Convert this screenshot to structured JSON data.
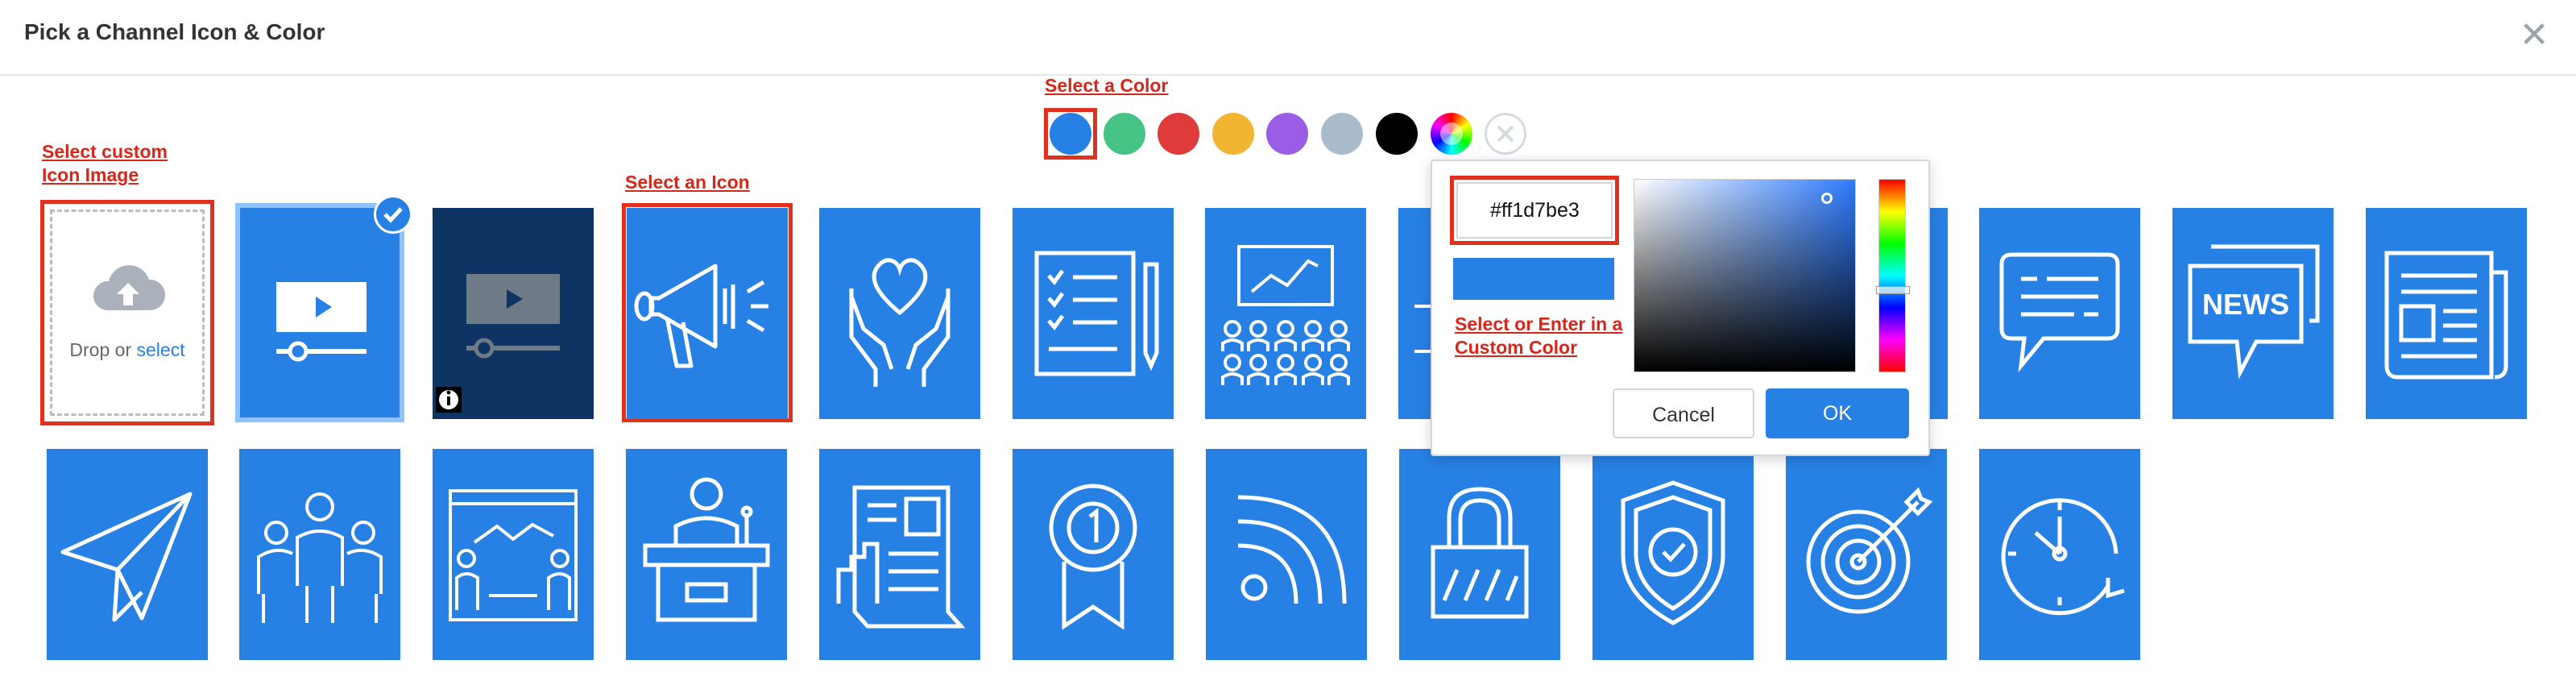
{
  "dialog": {
    "title": "Pick a Channel Icon & Color",
    "close_label": "✕"
  },
  "annotations": {
    "select_color": "Select a Color",
    "custom_image_line1": "Select custom",
    "custom_image_line2": "Icon Image",
    "select_icon": "Select an Icon",
    "custom_color_line1": "Select or Enter in a",
    "custom_color_line2": "Custom Color"
  },
  "colors": {
    "swatches": [
      {
        "name": "blue",
        "hex": "#2780e3",
        "selected": true
      },
      {
        "name": "green",
        "hex": "#45c486"
      },
      {
        "name": "red",
        "hex": "#e03b3b"
      },
      {
        "name": "yellow",
        "hex": "#f2b531"
      },
      {
        "name": "purple",
        "hex": "#9b5de5"
      },
      {
        "name": "gray",
        "hex": "#aabbcc"
      },
      {
        "name": "black",
        "hex": "#000000"
      },
      {
        "name": "rainbow",
        "icon": "color-wheel-icon"
      },
      {
        "name": "none",
        "icon": "no-color-icon"
      }
    ],
    "accent": "#2780e3",
    "annotation_red": "#d7261a"
  },
  "upload": {
    "drop_text": "Drop or",
    "select_link": "select",
    "icon": "cloud-upload-icon"
  },
  "color_picker": {
    "hex_value": "#ff1d7be3",
    "cancel_label": "Cancel",
    "ok_label": "OK",
    "preview_color": "#2780e3"
  },
  "icons_row1": [
    "video-player-icon",
    "video-player-dark-icon",
    "megaphone-icon",
    "hands-heart-icon",
    "checklist-icon",
    "presentation-audience-icon",
    "hidden-icon",
    "hidden-icon",
    "chat-bubble-icon",
    "news-bubble-icon",
    "newspaper-icon"
  ],
  "icons_row2": [
    "paper-plane-icon",
    "team-people-icon",
    "whiteboard-meeting-icon",
    "speaker-podium-icon",
    "report-document-icon",
    "award-ribbon-icon",
    "rss-feed-icon",
    "padlock-icon",
    "shield-check-icon",
    "target-dart-icon",
    "clock-refresh-icon"
  ],
  "news_label": "NEWS"
}
